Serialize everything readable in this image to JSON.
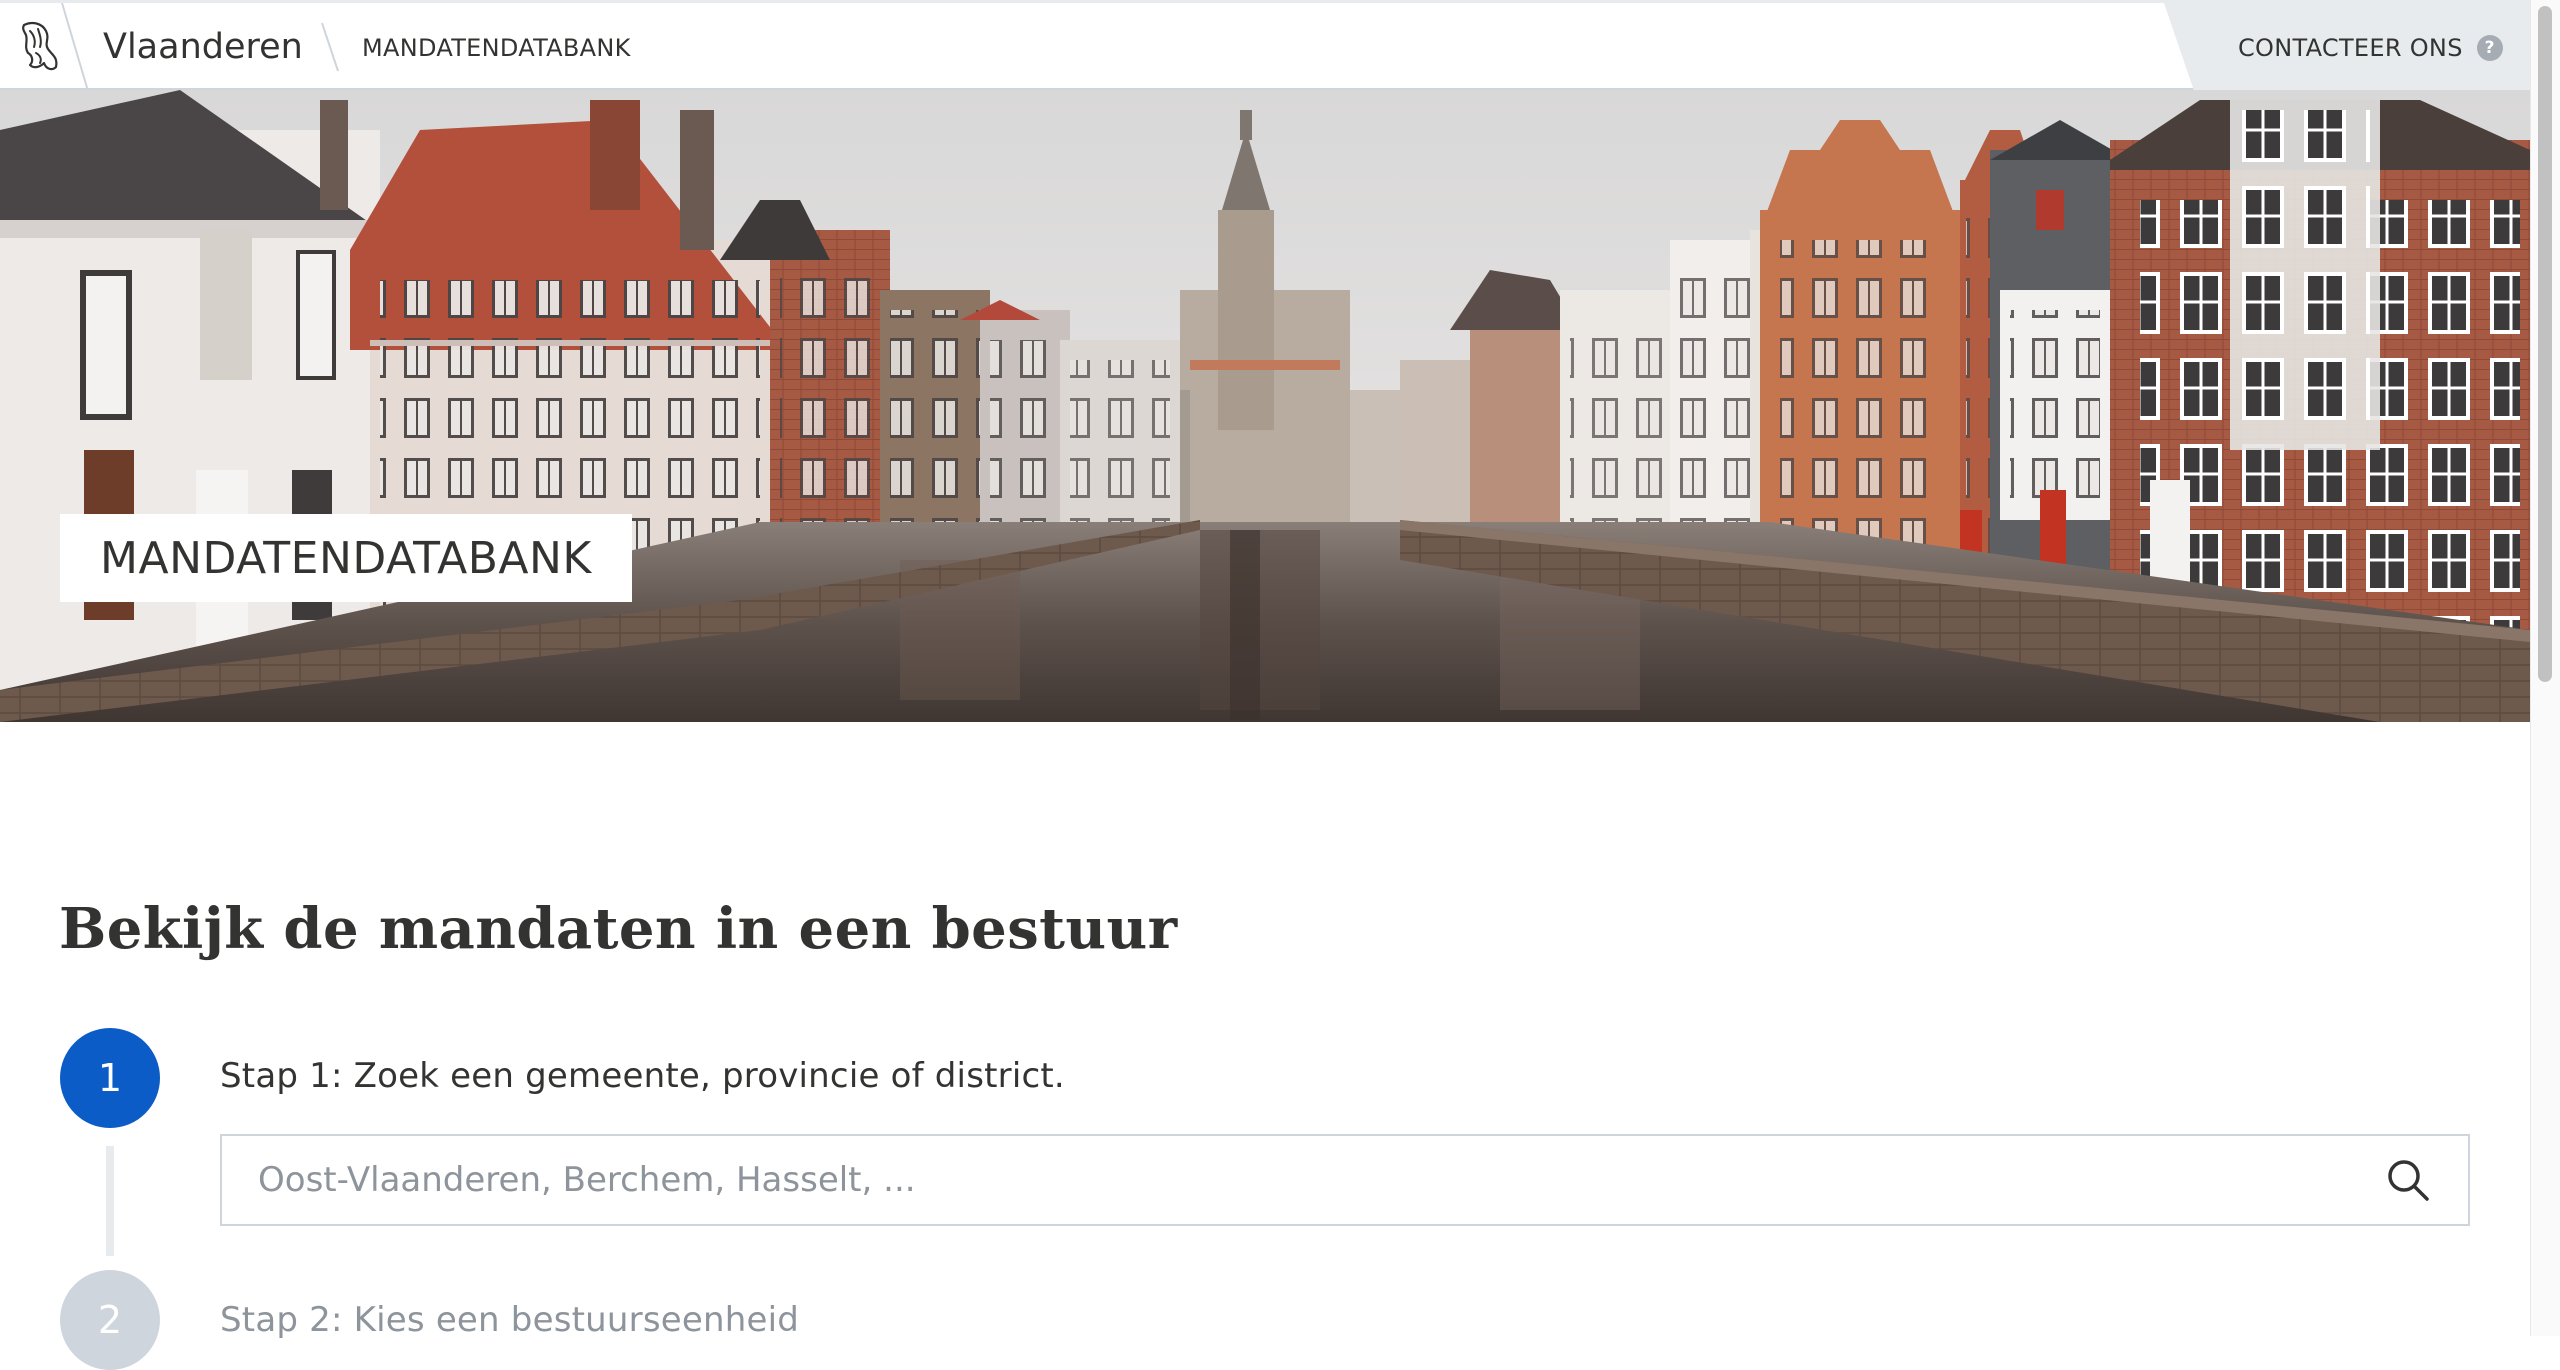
{
  "header": {
    "brand": "Vlaanderen",
    "breadcrumb": "MANDATENDATABANK",
    "contact_label": "CONTACTEER ONS",
    "help_glyph": "?",
    "logo_icon": "flemish-lion-icon"
  },
  "hero": {
    "title": "MANDATENDATABANK",
    "image": "bruges-canal-photo"
  },
  "main": {
    "heading": "Bekijk de mandaten in een bestuur",
    "steps": [
      {
        "number": "1",
        "label": "Stap 1: Zoek een gemeente, provincie of district.",
        "state": "active"
      },
      {
        "number": "2",
        "label": "Stap 2: Kies een bestuurseenheid",
        "state": "inactive"
      }
    ],
    "search": {
      "placeholder": "Oost-Vlaanderen, Berchem, Hasselt, ...",
      "value": "",
      "icon": "search-icon"
    }
  },
  "colors": {
    "accent": "#0b5cc7",
    "text": "#333332",
    "inactive": "#cfd5dd",
    "contact_bg": "#e8ebee"
  }
}
